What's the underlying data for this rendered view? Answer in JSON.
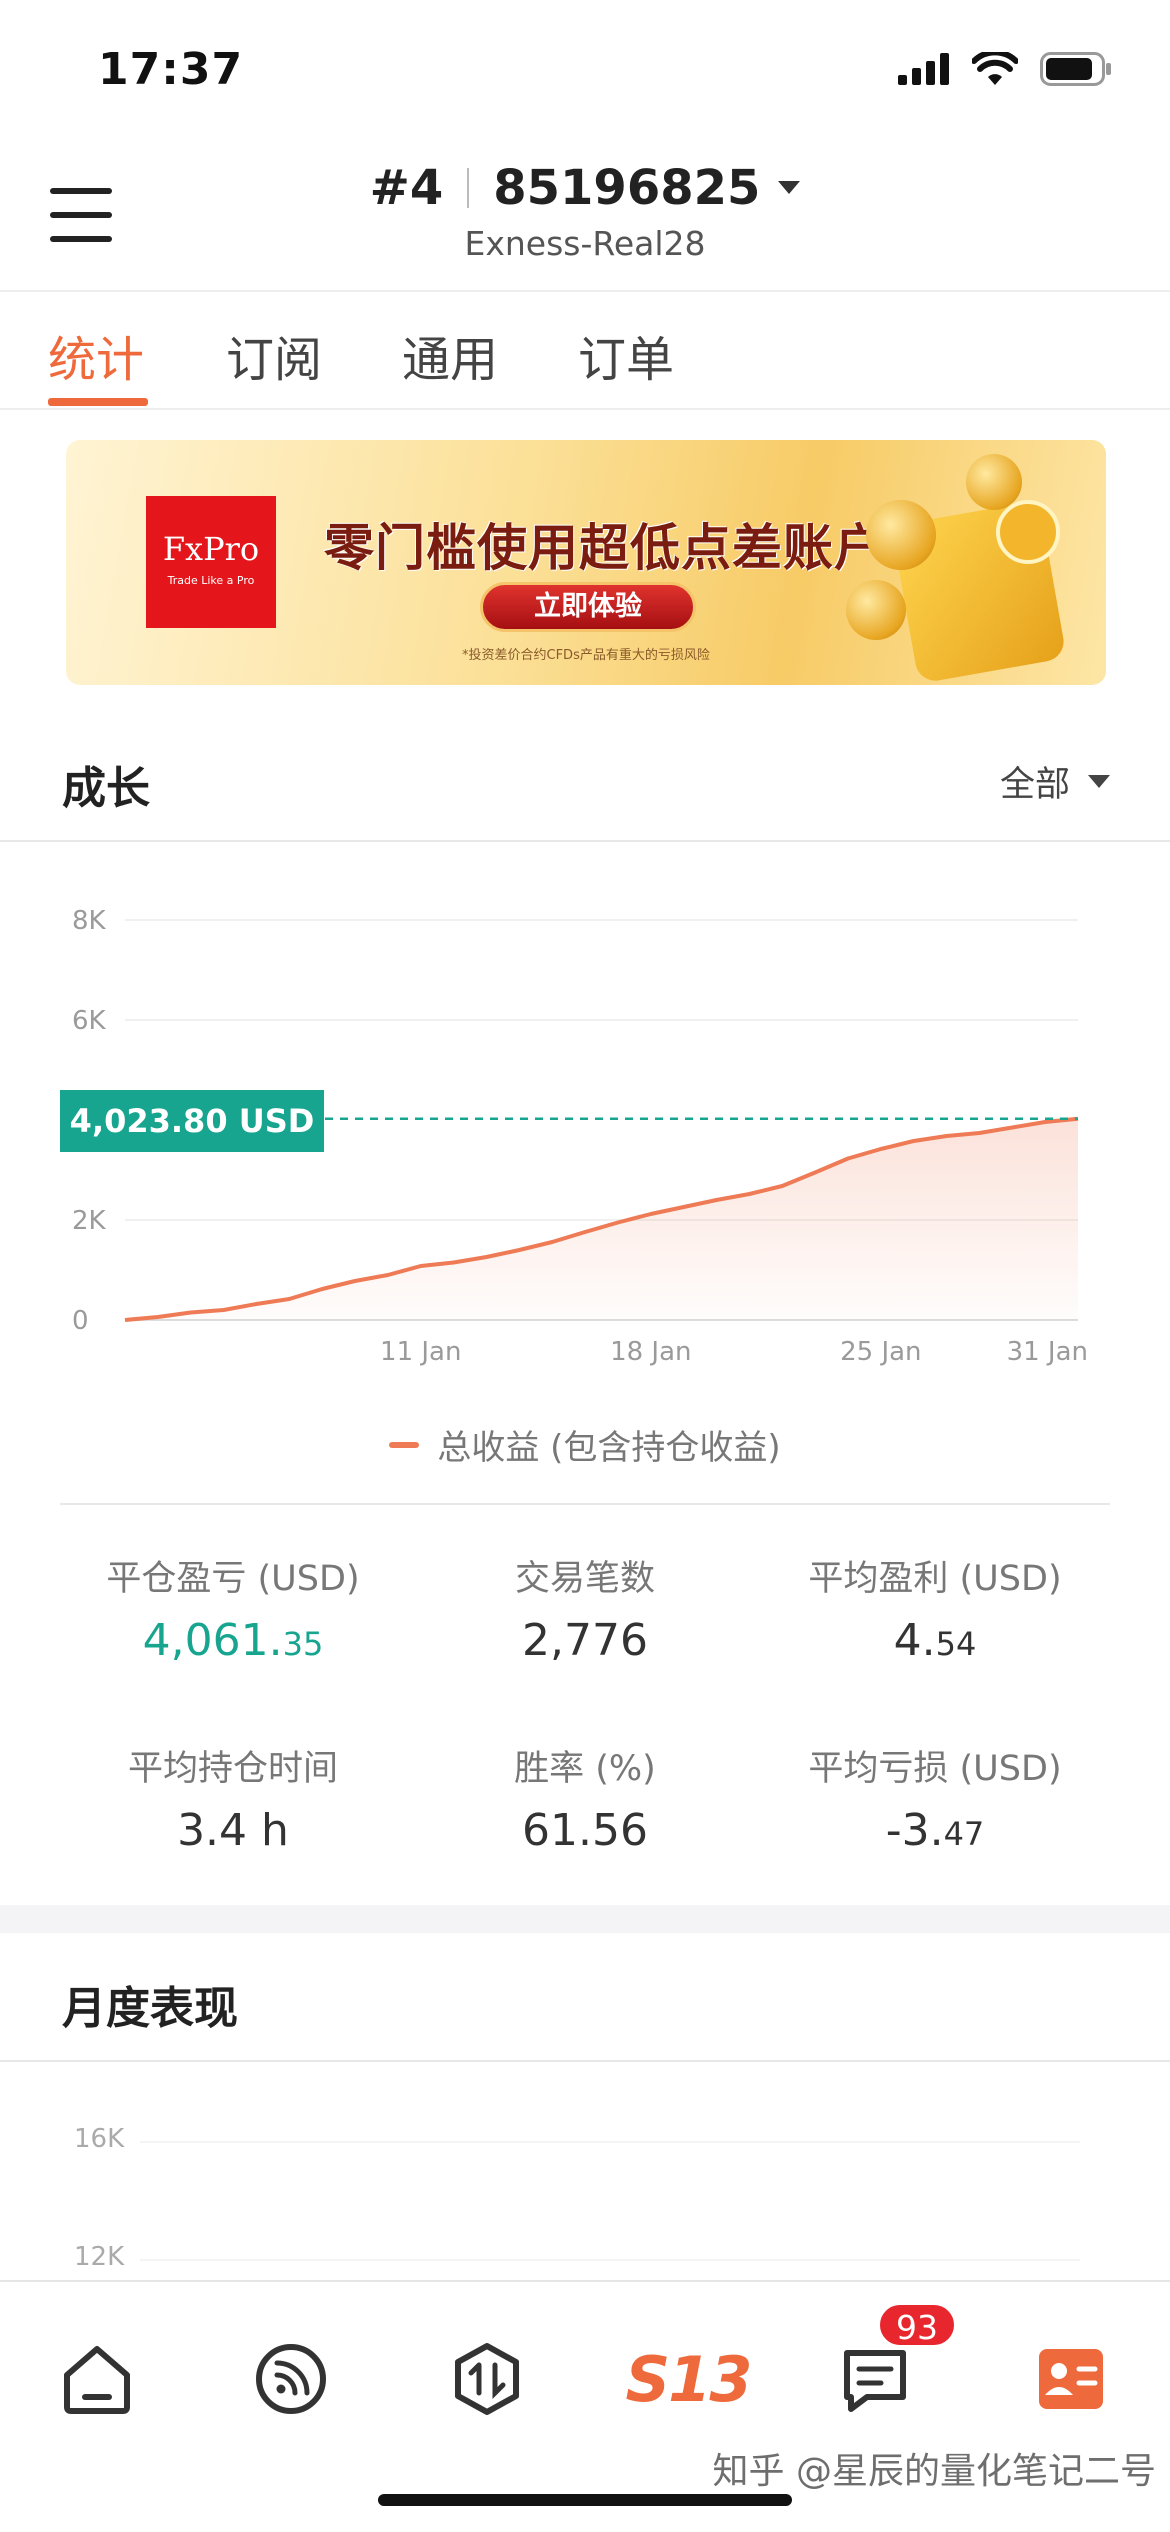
{
  "status_bar": {
    "time": "17:37"
  },
  "header": {
    "account_index": "#4",
    "account_number": "85196825",
    "server": "Exness-Real28"
  },
  "tabs": [
    {
      "label": "统计",
      "active": true
    },
    {
      "label": "订阅",
      "active": false
    },
    {
      "label": "通用",
      "active": false
    },
    {
      "label": "订单",
      "active": false
    }
  ],
  "banner": {
    "brand": "FxPro",
    "brand_tagline": "Trade Like a Pro",
    "title": "零门槛使用超低点差账户",
    "cta": "立即体验",
    "disclaimer": "*投资差价合约CFDs产品有重大的亏损风险"
  },
  "growth": {
    "title": "成长",
    "range_label": "全部",
    "current_value_label": "4,023.80 USD",
    "legend": "总收益 (包含持仓收益)"
  },
  "chart_data": {
    "type": "area",
    "title": "成长",
    "y_ticks": [
      "8K",
      "6K",
      "2K",
      "0"
    ],
    "x_ticks": [
      "11 Jan",
      "18 Jan",
      "25 Jan",
      "31 Jan"
    ],
    "ylim": [
      0,
      8000
    ],
    "x_range": [
      "2 Jan",
      "31 Jan"
    ],
    "series": [
      {
        "name": "总收益 (包含持仓收益)",
        "color": "#ee7b55",
        "points": [
          [
            "2 Jan",
            0
          ],
          [
            "3 Jan",
            60
          ],
          [
            "4 Jan",
            150
          ],
          [
            "5 Jan",
            200
          ],
          [
            "6 Jan",
            320
          ],
          [
            "7 Jan",
            420
          ],
          [
            "8 Jan",
            620
          ],
          [
            "9 Jan",
            780
          ],
          [
            "10 Jan",
            900
          ],
          [
            "11 Jan",
            1080
          ],
          [
            "12 Jan",
            1150
          ],
          [
            "13 Jan",
            1260
          ],
          [
            "14 Jan",
            1400
          ],
          [
            "15 Jan",
            1560
          ],
          [
            "16 Jan",
            1760
          ],
          [
            "17 Jan",
            1950
          ],
          [
            "18 Jan",
            2120
          ],
          [
            "19 Jan",
            2260
          ],
          [
            "20 Jan",
            2400
          ],
          [
            "21 Jan",
            2520
          ],
          [
            "22 Jan",
            2680
          ],
          [
            "23 Jan",
            2950
          ],
          [
            "24 Jan",
            3230
          ],
          [
            "25 Jan",
            3420
          ],
          [
            "26 Jan",
            3580
          ],
          [
            "27 Jan",
            3680
          ],
          [
            "28 Jan",
            3740
          ],
          [
            "29 Jan",
            3850
          ],
          [
            "30 Jan",
            3960
          ],
          [
            "31 Jan",
            4023.8
          ]
        ]
      }
    ],
    "reference_line": {
      "value": 4023.8,
      "label": "4,023.80 USD",
      "color": "#17a58f",
      "style": "dashed"
    },
    "grid": true
  },
  "stats": [
    {
      "label": "平仓盈亏 (USD)",
      "int": "4,061.",
      "dec": "35",
      "positive": true
    },
    {
      "label": "交易笔数",
      "int": "2,776",
      "dec": "",
      "positive": false
    },
    {
      "label": "平均盈利 (USD)",
      "int": "4.",
      "dec": "54",
      "positive": false
    },
    {
      "label": "平均持仓时间",
      "int": "3.4 h",
      "dec": "",
      "positive": false
    },
    {
      "label": "胜率 (%)",
      "int": "61.56",
      "dec": "",
      "positive": false
    },
    {
      "label": "平均亏损 (USD)",
      "int": "-3.",
      "dec": "47",
      "positive": false
    }
  ],
  "monthly": {
    "title": "月度表现",
    "y_ticks": [
      "16K",
      "12K"
    ]
  },
  "bottom_nav": {
    "items": [
      "home-icon",
      "feed-icon",
      "trade-icon",
      "s13-logo-icon",
      "messages-icon",
      "profile-card-icon"
    ],
    "brand_text": "S13",
    "messages_badge": "93"
  },
  "watermark": "知乎 @星辰的量化笔记二号",
  "colors": {
    "accent": "#ee6a3c",
    "positive": "#17a58f",
    "series": "#ee7b55"
  }
}
